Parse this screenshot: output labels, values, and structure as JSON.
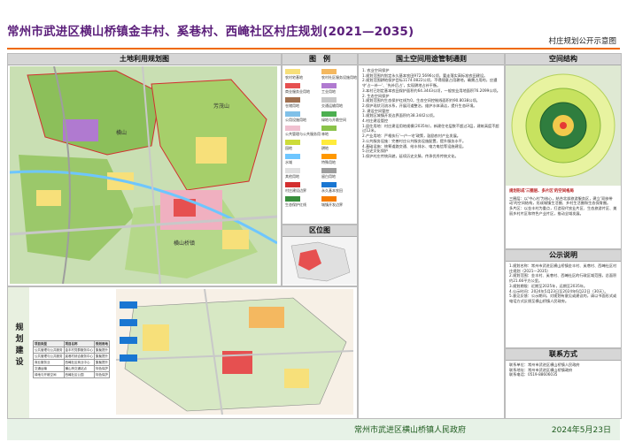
{
  "title": "常州市武进区横山桥镇金丰村、奚巷村、西崦社区村庄规划(2021—2035)",
  "subtitle": "村庄规划公开示意图",
  "sections": {
    "land_use": "土地利用规划图",
    "legend": "图　例",
    "control": "国土空间用途管制通则",
    "structure": "空间结构",
    "location": "区位图",
    "public": "公示说明",
    "planning": "规划建设",
    "contact": "联系方式"
  },
  "map_labels": {
    "label_1": "横山桥镇",
    "label_2": "横山",
    "label_3": "芳茂山"
  },
  "control_text": [
    "1. 农业空间保护",
    "1.规划范围内划定永久基本农田972.5696公顷，要走落实高标准农田建设。",
    "2.规划范围耕地保护目标1174.0822公顷，不得随意占用耕地，确需占用的，应遵守'占一补一'、'先补后占'，实现耕地占补平衡。",
    "3.本村已划定基本农田保护面积约64.3443公顷，一般农业用地面积76.2099公顷。",
    "2. 生态空间保护",
    "1.规划范围内生态保护红线为0，生态空间控制线面积约90.8038公顷。",
    "2.保护现状河流水系，开展河道整治，维护水体清洁，提升生态环境。",
    "3. 建设空间管控",
    "1.规划区城镇开发边界面积约38.3442公顷。",
    "4.村庄建设管控",
    "1.居住用地：村庄建设用地规模(2035年)，新建住宅层数不超过3层，建筑高度不超过12米。",
    "2.产业用地：严格执行'一户一宅'政策，鼓励农村产业发展。",
    "3.公共服务设施：完善村庄公共服务设施配置，提升服务水平。",
    "4.基础设施：统筹道路交通、给水排水、电力电信等设施建设。",
    "5.历史文化保护",
    "1.保护村庄传统风貌，延续历史文脉，传承优秀传统文化。"
  ],
  "structure_labels": {
    "caption": "规划形成'三圈层、多片区'的空间格局",
    "text": [
      "三圈层：以'中心村'为核心，结合北部旅游服务区，建立'双核带动'的空间结构，形成城镇生活圈、乡村生活圈和生态保育圈。",
      "多片区：以金丰村为重点，打造现代农业片区、生态旅游片区、美丽乡村片区和特色产业片区，推动全域发展。"
    ]
  },
  "public_text": [
    "1.规划名称：常州市武进区横山桥镇金丰村、奚巷村、西崦社区村庄规划（2021—2035）",
    "2.规划范围：金丰村、奚巷村、西崦社区的行政区域范围，总面积约21.66平方公里。",
    "3.规划期限：近期至2025年，远期至2035年。",
    "4.公示时间：2024年5月23日至2024年6月22日（30天）。",
    "5.意见反馈：公示期间，对规划有意见或建议的，请以书面形式或电话方式反馈至横山桥镇人民政府。"
  ],
  "contact_text": [
    "联系单位：常州市武进区横山桥镇人民政府",
    "联系地址：常州市武进区横山桥镇政府",
    "联系电话：0519-88606035"
  ],
  "planning_table": {
    "headers": [
      "项目类型",
      "项目名称",
      "规划用地"
    ],
    "rows": [
      [
        "公共管理与公共服务",
        "金丰村党群服务中心",
        "集聚提升"
      ],
      [
        "公共管理与公共服务",
        "奚巷村综合服务中心",
        "集聚提升"
      ],
      [
        "商业服务业",
        "西崦社区商业中心",
        "集聚提升"
      ],
      [
        "交通运输",
        "横山桥交通站点",
        "特色保护"
      ],
      [
        "绿地与开敞空间",
        "西崦社区公园",
        "特色保护"
      ]
    ]
  },
  "legend_items": [
    {
      "color": "#f7e07a",
      "label": "农村宅基地"
    },
    {
      "color": "#f4b860",
      "label": "农村社区服务设施用地"
    },
    {
      "color": "#e65050",
      "label": "商业服务业用地"
    },
    {
      "color": "#b07ad0",
      "label": "工业用地"
    },
    {
      "color": "#a07050",
      "label": "仓储用地"
    },
    {
      "color": "#c8c8c8",
      "label": "交通运输用地"
    },
    {
      "color": "#80c0e8",
      "label": "公用设施用地"
    },
    {
      "color": "#4caf50",
      "label": "绿地与开敞空间"
    },
    {
      "color": "#f0c0d0",
      "label": "公共管理与公共服务用地"
    },
    {
      "color": "#8bc34a",
      "label": "林地"
    },
    {
      "color": "#cddc39",
      "label": "园地"
    },
    {
      "color": "#ffeb3b",
      "label": "耕地"
    },
    {
      "color": "#6ec6ff",
      "label": "水域"
    },
    {
      "color": "#ff9800",
      "label": "特殊用地"
    },
    {
      "color": "#e0e0e0",
      "label": "其他用地"
    },
    {
      "color": "#9e9e9e",
      "label": "留白用地"
    },
    {
      "color": "#d32f2f",
      "label": "村庄建设边界"
    },
    {
      "color": "#1976d2",
      "label": "永久基本农田"
    },
    {
      "color": "#388e3c",
      "label": "生态保护红线"
    },
    {
      "color": "#f57c00",
      "label": "城镇开发边界"
    }
  ],
  "footer": {
    "org": "常州市武进区横山桥镇人民政府",
    "date": "2024年5月23日"
  },
  "colors": {
    "accent": "#ef6a00",
    "title": "#5b1e7a",
    "footer_bg": "#e7f2e7"
  }
}
